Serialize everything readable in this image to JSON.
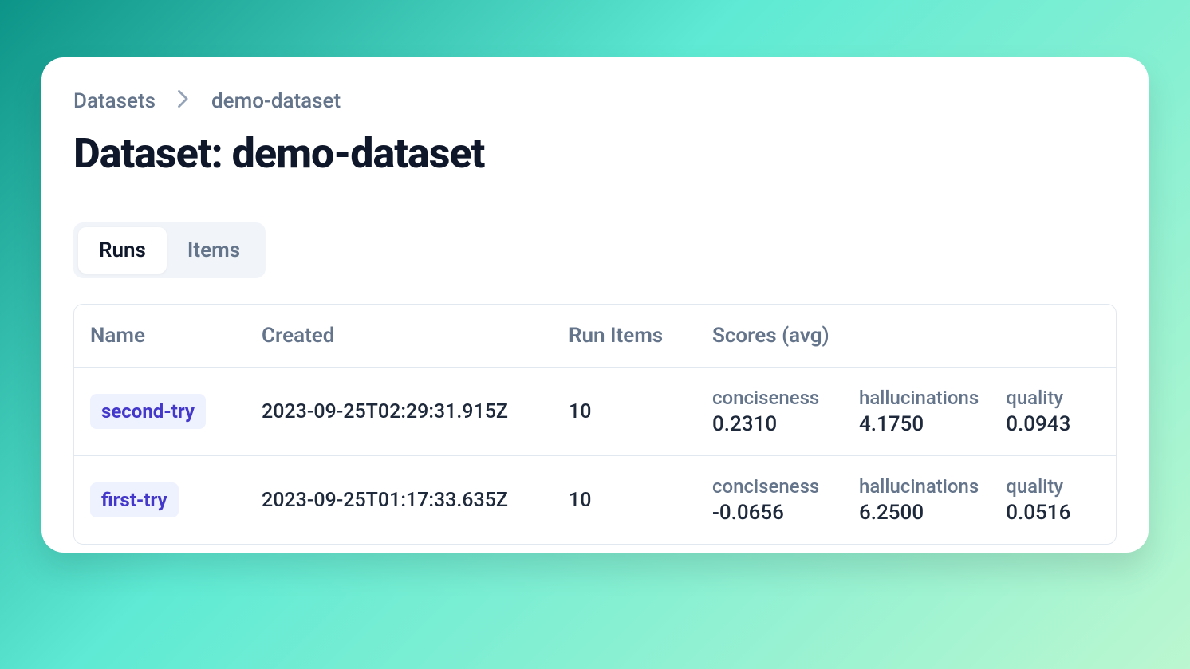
{
  "breadcrumb": {
    "root": "Datasets",
    "current": "demo-dataset"
  },
  "title": "Dataset: demo-dataset",
  "tabs": [
    {
      "label": "Runs",
      "active": true
    },
    {
      "label": "Items",
      "active": false
    }
  ],
  "table": {
    "headers": {
      "name": "Name",
      "created": "Created",
      "runItems": "Run Items",
      "scores": "Scores (avg)"
    },
    "rows": [
      {
        "name": "second-try",
        "created": "2023-09-25T02:29:31.915Z",
        "runItems": "10",
        "scores": [
          {
            "label": "conciseness",
            "value": "0.2310"
          },
          {
            "label": "hallucinations",
            "value": "4.1750"
          },
          {
            "label": "quality",
            "value": "0.0943"
          }
        ]
      },
      {
        "name": "first-try",
        "created": "2023-09-25T01:17:33.635Z",
        "runItems": "10",
        "scores": [
          {
            "label": "conciseness",
            "value": "-0.0656"
          },
          {
            "label": "hallucinations",
            "value": "6.2500"
          },
          {
            "label": "quality",
            "value": "0.0516"
          }
        ]
      }
    ]
  }
}
